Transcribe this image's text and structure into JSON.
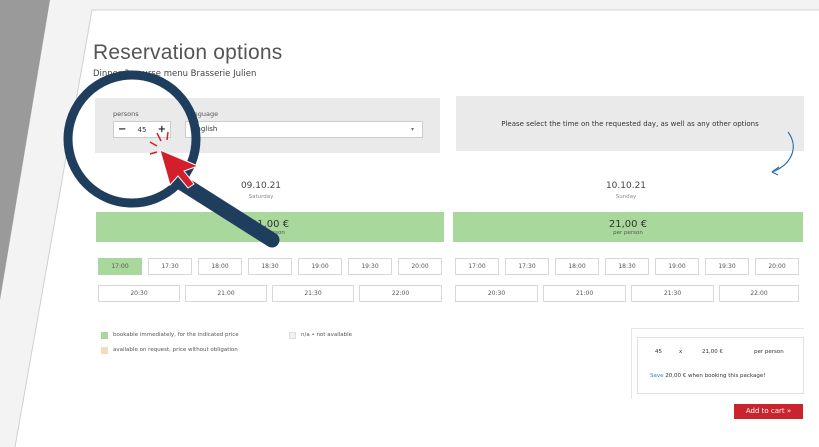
{
  "header": {
    "title": "Reservation options",
    "subtitle": "Dinner 3-course menu Brasserie Julien"
  },
  "options": {
    "persons_label": "persons",
    "persons_value": "45",
    "minus": "−",
    "plus": "+",
    "language_label": "Language",
    "language_value": "English",
    "caret": "▾"
  },
  "notice": "Please select the time on the requested day, as well as any other options",
  "days": [
    {
      "date": "09.10.21",
      "weekday": "Saturday",
      "price": "21,00 €",
      "price_note": "per person",
      "slots_row1": [
        "17:00",
        "17:30",
        "18:00",
        "18:30",
        "19:00",
        "19:30",
        "20:00"
      ],
      "slots_row2": [
        "20:30",
        "21:00",
        "21:30",
        "22:00"
      ]
    },
    {
      "date": "10.10.21",
      "weekday": "Sunday",
      "price": "21,00 €",
      "price_note": "per person",
      "slots_row1": [
        "17:00",
        "17:30",
        "18:00",
        "18:30",
        "19:00",
        "19:30",
        "20:00"
      ],
      "slots_row2": [
        "20:30",
        "21:00",
        "21:30",
        "22:00"
      ]
    }
  ],
  "legend": {
    "bookable": "bookable immediately, for the indicated price",
    "on_request": "available on request, price without obligation",
    "not_available": "n/a • not available"
  },
  "summary": {
    "qty": "45",
    "times": "x",
    "unit_price": "21,00 €",
    "per": "per person",
    "save_prefix": "Save",
    "save_text": "20,00 € when booking this package!",
    "add_to_cart": "Add to cart »"
  },
  "colors": {
    "bookable": "#a9d89c",
    "on_request": "#f4dcbf",
    "not_available": "#f2f2f2",
    "cart": "#c9232e",
    "magnifier": "#1f3d5c",
    "cursor": "#d21f2b"
  }
}
